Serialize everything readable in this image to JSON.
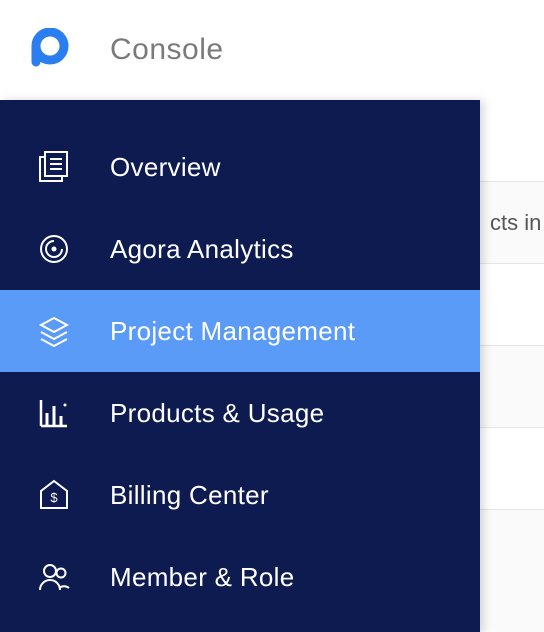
{
  "header": {
    "title": "Console",
    "logo_letter": "a"
  },
  "sidebar": {
    "items": [
      {
        "id": "overview",
        "label": "Overview",
        "icon": "overview-icon",
        "active": false
      },
      {
        "id": "analytics",
        "label": "Agora Analytics",
        "icon": "analytics-icon",
        "active": false
      },
      {
        "id": "project",
        "label": "Project Management",
        "icon": "layers-icon",
        "active": true
      },
      {
        "id": "products",
        "label": "Products & Usage",
        "icon": "chart-icon",
        "active": false
      },
      {
        "id": "billing",
        "label": "Billing Center",
        "icon": "billing-icon",
        "active": false
      },
      {
        "id": "member",
        "label": "Member & Role",
        "icon": "users-icon",
        "active": false
      }
    ]
  },
  "content_peek": {
    "row_text": "cts in"
  }
}
